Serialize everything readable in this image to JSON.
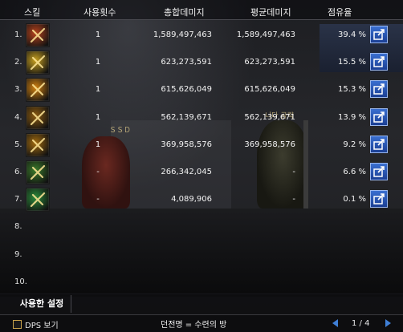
{
  "header": {
    "skill": "스킬",
    "uses": "사용횟수",
    "total": "총합데미지",
    "avg": "평균데미지",
    "share": "점유율"
  },
  "scene": {
    "name_left": "ＳＳＤ",
    "name_right": "니다 공략"
  },
  "rows": [
    {
      "num": "1.",
      "icon": "crossed-swords-fire-icon",
      "color": "#b5421c",
      "uses": "1",
      "total": "1,589,497,463",
      "avg": "1,589,497,463",
      "share": "39.4 %"
    },
    {
      "num": "2.",
      "icon": "golden-blade-slash-icon",
      "color": "#c8a020",
      "uses": "1",
      "total": "623,273,591",
      "avg": "623,273,591",
      "share": "15.5 %"
    },
    {
      "num": "3.",
      "icon": "fire-orb-icon",
      "color": "#d08010",
      "uses": "1",
      "total": "615,626,049",
      "avg": "615,626,049",
      "share": "15.3 %"
    },
    {
      "num": "4.",
      "icon": "golden-ring-icon",
      "color": "#8a5a10",
      "uses": "1",
      "total": "562,139,671",
      "avg": "562,139,671",
      "share": "13.9 %"
    },
    {
      "num": "5.",
      "icon": "spiral-strike-icon",
      "color": "#a06a10",
      "uses": "1",
      "total": "369,958,576",
      "avg": "369,958,576",
      "share": "9.2 %"
    },
    {
      "num": "6.",
      "icon": "green-rune-icon",
      "color": "#3a7a2a",
      "uses": "-",
      "total": "266,342,045",
      "avg": "-",
      "share": "6.6 %"
    },
    {
      "num": "7.",
      "icon": "green-wind-icon",
      "color": "#2a8a3a",
      "uses": "-",
      "total": "4,089,906",
      "avg": "-",
      "share": "0.1 %"
    },
    {
      "num": "8.",
      "icon": "",
      "uses": "",
      "total": "",
      "avg": "",
      "share": ""
    },
    {
      "num": "9.",
      "icon": "",
      "uses": "",
      "total": "",
      "avg": "",
      "share": ""
    },
    {
      "num": "10.",
      "icon": "",
      "uses": "",
      "total": "",
      "avg": "",
      "share": ""
    }
  ],
  "tabs": {
    "settings": "사용한 설정"
  },
  "footer": {
    "dps_label": "DPS 보기",
    "dungeon": "던전명 = 수련의 방",
    "page": "1 / 4"
  }
}
